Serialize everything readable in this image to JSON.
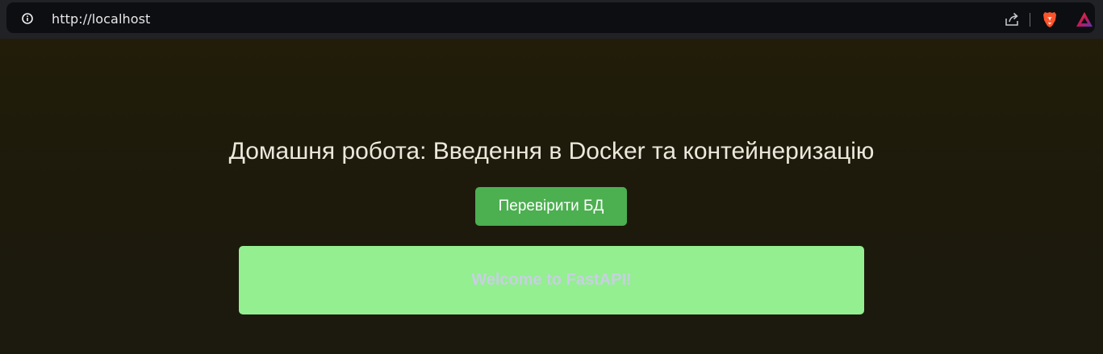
{
  "browser": {
    "url": "http://localhost",
    "icons": [
      "info-icon",
      "share-icon",
      "brave-shields-icon",
      "brave-rewards-icon"
    ]
  },
  "page": {
    "title": "Домашня робота: Введення в Docker та контейнеризацію",
    "check_db_label": "Перевірити БД",
    "message": "Welcome to FastAPI!"
  },
  "colors": {
    "background": "#1e1a09",
    "button": "#4caf50",
    "message_box": "#93ef90",
    "message_text": "#c8cfe2"
  }
}
